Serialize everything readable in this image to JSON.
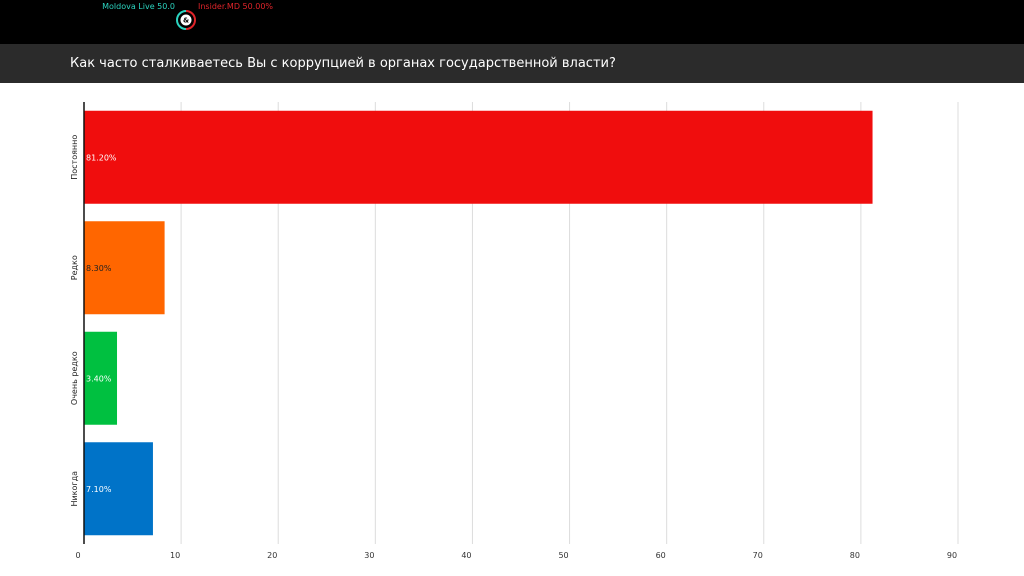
{
  "sources": {
    "left_label": "Moldova Live 50.0",
    "right_label": "Insider.MD 50.00%",
    "left_color": "#2bd4c0",
    "right_color": "#e0242a"
  },
  "chart_data": {
    "type": "bar",
    "orientation": "horizontal",
    "title": "Как часто сталкиваетесь Вы с коррупцией в органах государственной власти?",
    "categories": [
      "Постоянно",
      "Редко",
      "Очень редко",
      "Никогда"
    ],
    "values": [
      81.2,
      8.3,
      3.4,
      7.1
    ],
    "value_labels": [
      "81.20%",
      "8.30%",
      "3.40%",
      "7.10%"
    ],
    "colors": [
      "#f00d0d",
      "#ff6600",
      "#00c040",
      "#0073c8"
    ],
    "label_colors": [
      "#ffffff",
      "#222222",
      "#ffffff",
      "#ffffff"
    ],
    "xlim": [
      0,
      90
    ],
    "xticks": [
      "0",
      "10",
      "20",
      "30",
      "40",
      "50",
      "60",
      "70",
      "80",
      "90"
    ],
    "xlabel": "",
    "ylabel": "",
    "grid": true,
    "legend": "none"
  }
}
